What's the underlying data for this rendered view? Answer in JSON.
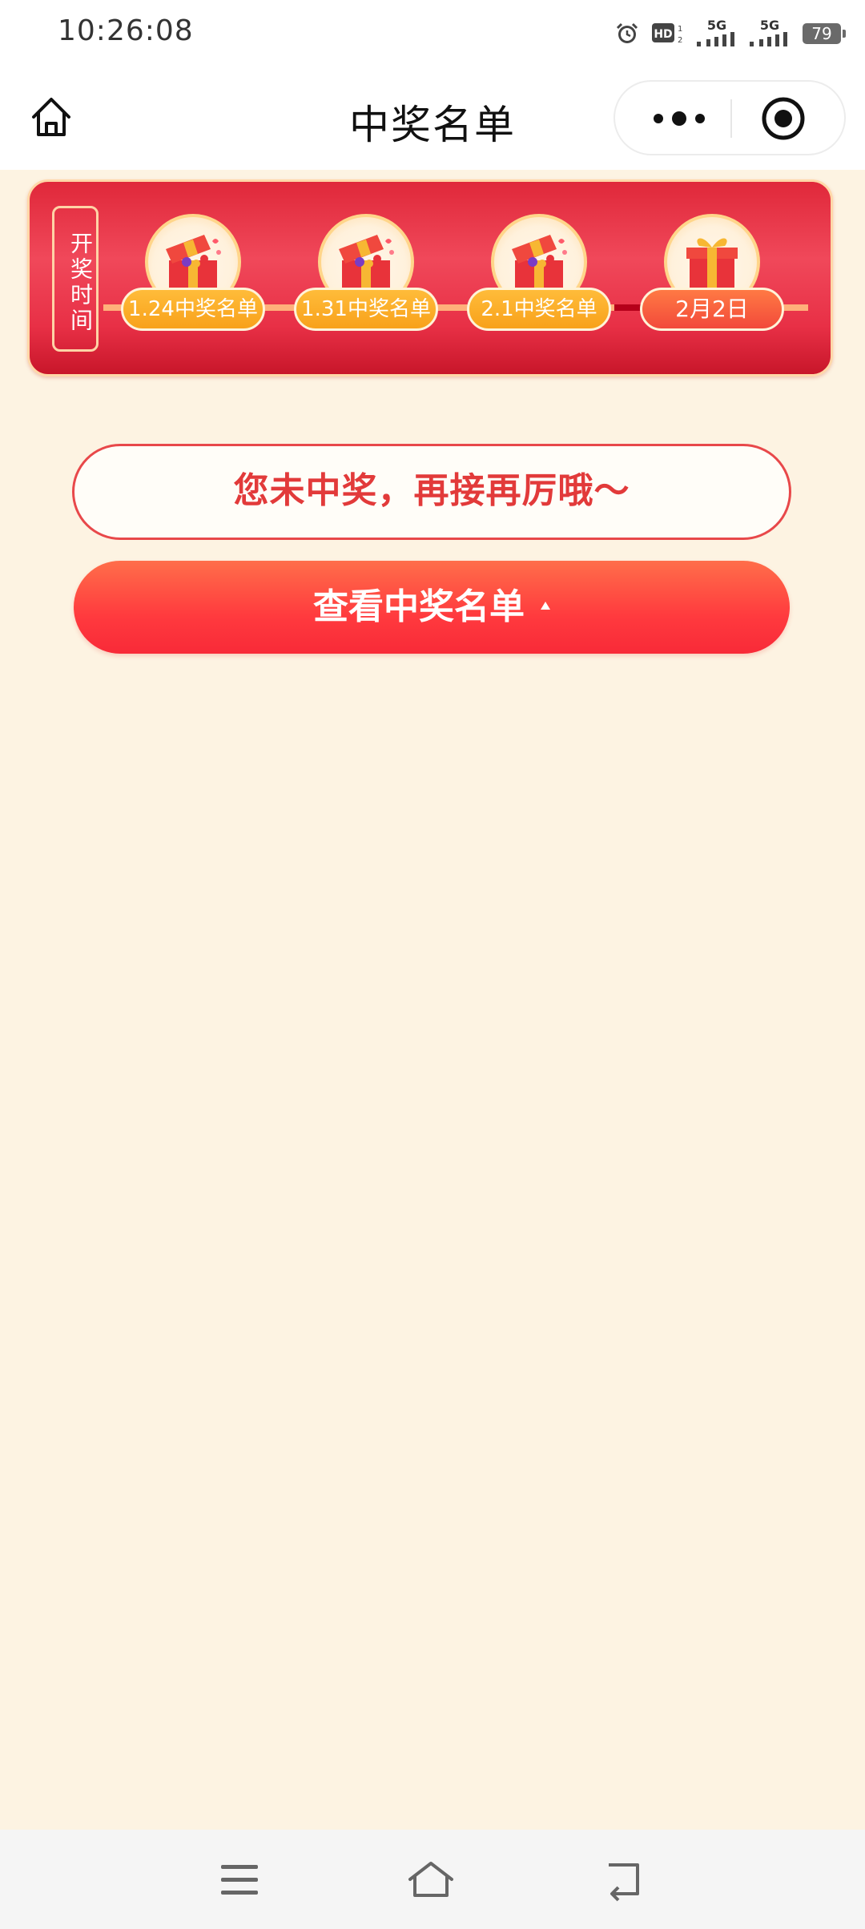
{
  "status_bar": {
    "time": "10:26:08",
    "signal_label_1": "5G",
    "signal_label_2": "5G",
    "hd_label": "HD",
    "battery": "79"
  },
  "nav_bar": {
    "title": "中奖名单"
  },
  "banner": {
    "draw_time_label": "开奖时间",
    "stages": [
      {
        "label": "1.24中奖名单",
        "icon": "gift-box-open-icon"
      },
      {
        "label": "1.31中奖名单",
        "icon": "gift-box-open-icon"
      },
      {
        "label": "2.1中奖名单",
        "icon": "gift-box-open-icon"
      },
      {
        "label": "2月2日",
        "icon": "gift-box-closed-icon"
      }
    ]
  },
  "result": {
    "message": "您未中奖，再接再厉哦～"
  },
  "actions": {
    "view_winners_label": "查看中奖名单"
  },
  "colors": {
    "page_bg": "#fdf3e2",
    "banner_red": "#e0283a",
    "accent_orange": "#f8a11a",
    "text_red": "#e23a3a"
  }
}
